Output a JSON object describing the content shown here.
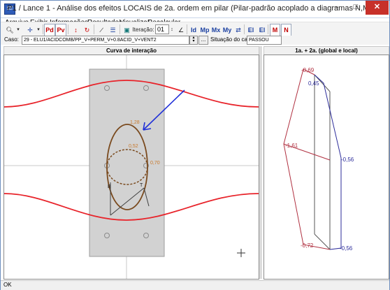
{
  "window": {
    "title": "P1 / Lance 1 - Análise dos efeitos LOCAIS de 2a. ordem em pilar (Pilar-padrão acoplado a diagramas N,M,1/r)",
    "app_icon_text": "SE"
  },
  "menu": [
    "Arquivo",
    "Exibir",
    "Informações",
    "Resultados",
    "Visualizar",
    "Recalcular"
  ],
  "toolbar": {
    "buttons": [
      "Pd",
      "Pv"
    ],
    "iteration_label": "Iteração:",
    "iteration_value": "01",
    "icon_text": [
      "Id",
      "Mp",
      "Mx",
      "My",
      "El",
      "El",
      "M",
      "N"
    ]
  },
  "case": {
    "label": "Caso:",
    "value": "29 - ELU1/ACIDCOMB/PP_V+PERM_V+0.8ACID_V+VENT2",
    "dots": "...",
    "situation_label": "Situação do caso:",
    "situation_value": "PASSOU"
  },
  "left_panel": {
    "title": "Curva de interação",
    "labels": {
      "top": "1,28",
      "mid": "0,52",
      "right": "0,70",
      "B": "B",
      "T": "T"
    }
  },
  "right_panel": {
    "title": "1a. + 2a. (global e local)",
    "labels": [
      "-0,69",
      "0,45",
      "-1,61",
      "-0,56",
      "-0,72",
      "-0,56"
    ]
  },
  "status": {
    "text": "OK"
  },
  "colors": {
    "curve_red": "#e8232a",
    "ellipse_brown": "#7a4a1e",
    "arrow_blue": "#1f2fd8",
    "diagram_red": "#b03040",
    "diagram_blue": "#2b2b9a"
  }
}
